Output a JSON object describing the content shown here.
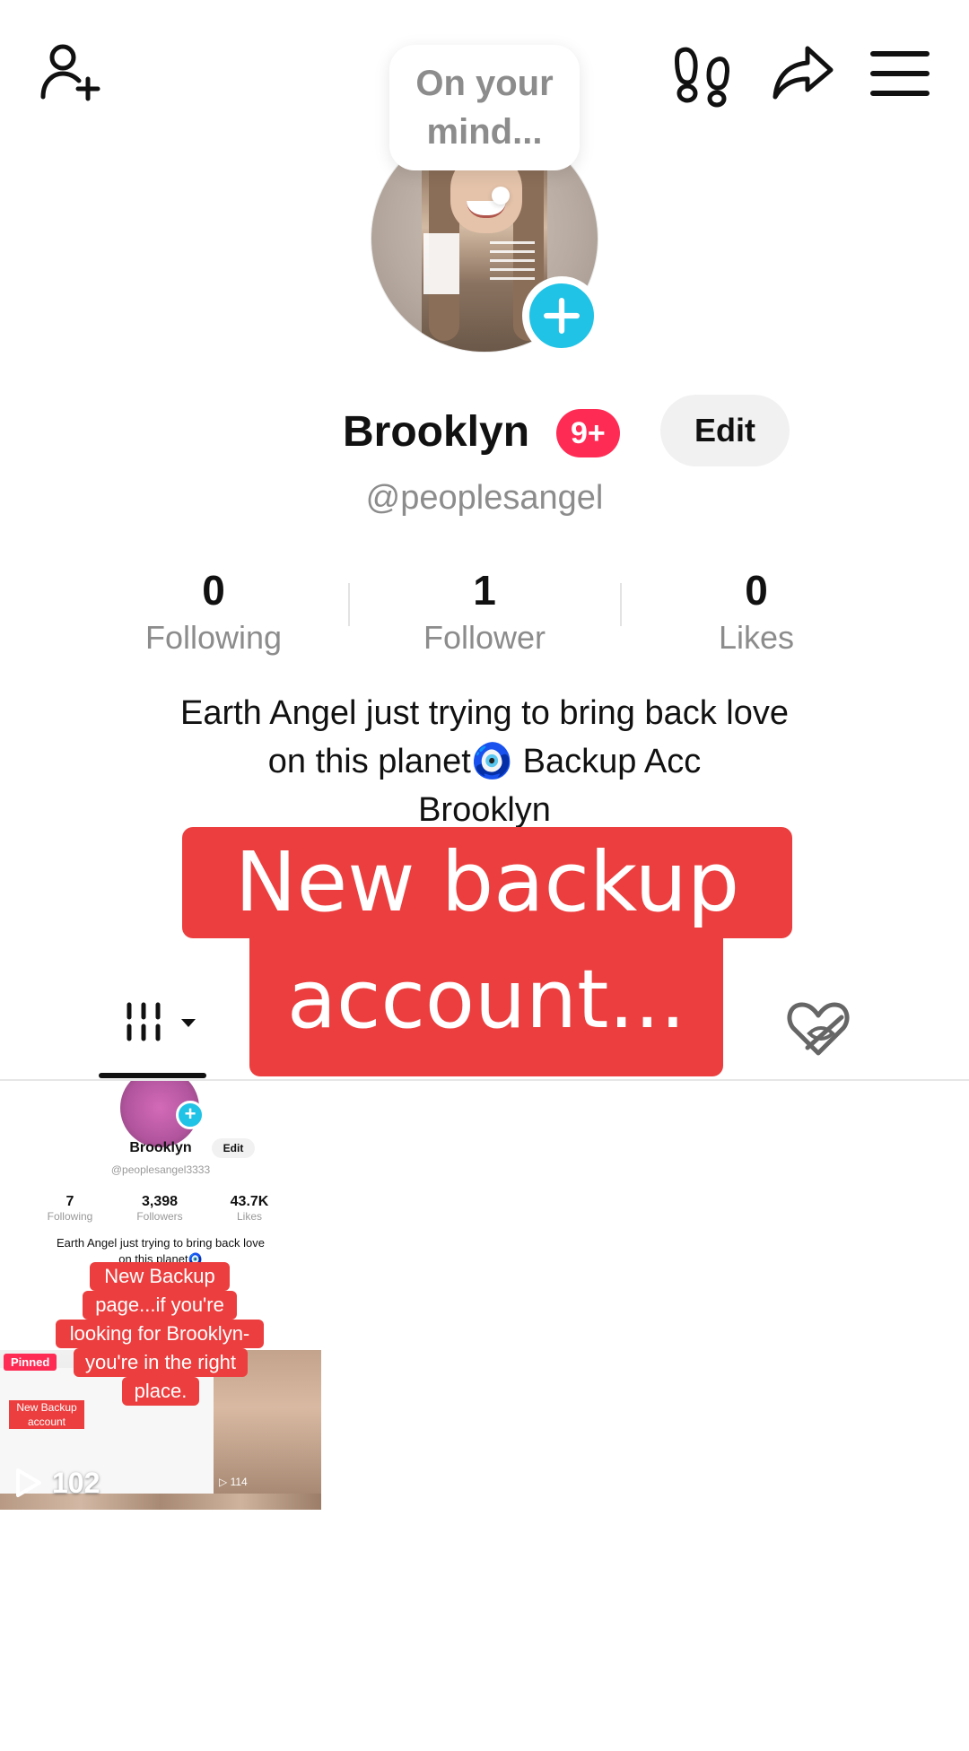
{
  "header": {
    "add_friend_icon": "person-plus-icon",
    "footprints_icon": "footprints-icon",
    "share_icon": "share-arrow-icon",
    "menu_icon": "hamburger-menu-icon"
  },
  "bubble": {
    "text_line1": "On your",
    "text_line2": "mind..."
  },
  "profile": {
    "name": "Brooklyn",
    "notification_badge": "9+",
    "edit_label": "Edit",
    "handle": "@peoplesangel",
    "stats": [
      {
        "value": "0",
        "label": "Following"
      },
      {
        "value": "1",
        "label": "Follower"
      },
      {
        "value": "0",
        "label": "Likes"
      }
    ],
    "bio_line1": "Earth Angel just trying to bring back love",
    "bio_line2": "on this planet🧿 Backup Acc",
    "bio_line3": "Brooklyn"
  },
  "overlay_caption": {
    "line1": "New backup",
    "line2": "account..."
  },
  "tabs": {
    "videos_icon": "grid-icon",
    "liked_icon": "liked-hidden-icon"
  },
  "videos": [
    {
      "views": "102",
      "preview": {
        "name": "Brooklyn",
        "edit_label": "Edit",
        "handle": "@peoplesangel3333",
        "stats": [
          {
            "value": "7",
            "label": "Following"
          },
          {
            "value": "3,398",
            "label": "Followers"
          },
          {
            "value": "43.7K",
            "label": "Likes"
          }
        ],
        "bio_line1": "Earth Angel just trying to bring back love",
        "bio_line2": "on this planet🧿",
        "caption_lines": [
          "New Backup",
          "page...if you're",
          "looking for Brooklyn-",
          "you're in the right",
          "place."
        ],
        "pinned_label": "Pinned",
        "inner_caption_line1": "New Backup",
        "inner_caption_line2": "account",
        "inner_views": "114"
      }
    }
  ],
  "colors": {
    "accent_red": "#fe2c55",
    "caption_red": "#ec3e3e",
    "plus_blue": "#20c3e6",
    "muted_text": "#8c8c8c"
  }
}
